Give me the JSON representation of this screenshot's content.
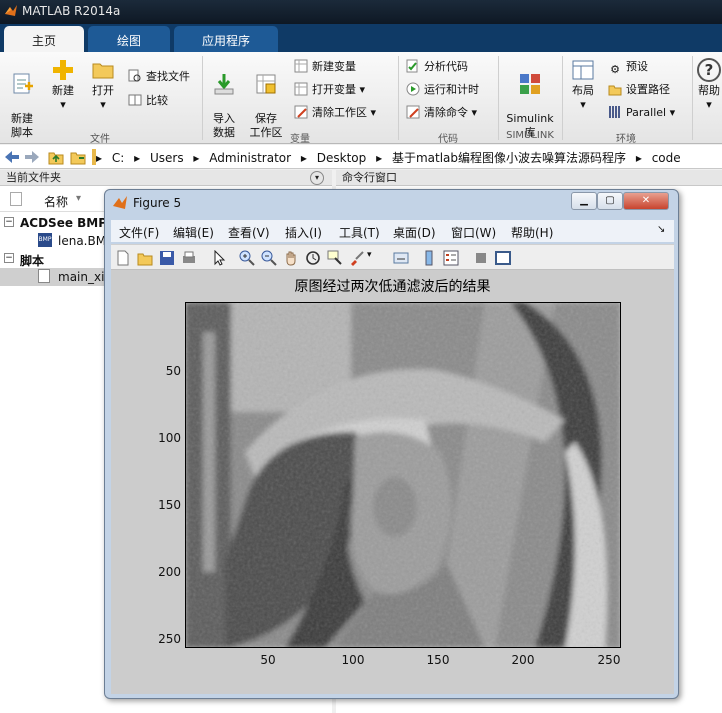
{
  "app": {
    "title": "MATLAB R2014a"
  },
  "tabs": [
    {
      "label": "主页"
    },
    {
      "label": "绘图"
    },
    {
      "label": "应用程序"
    }
  ],
  "ribbon": {
    "new_script": "新建\n脚本",
    "new": "新建",
    "open": "打开",
    "find_files": "查找文件",
    "compare": "比较",
    "import_data": "导入\n数据",
    "save_workspace": "保存\n工作区",
    "new_variable": "新建变量",
    "open_variable": "打开变量",
    "clear_workspace": "清除工作区",
    "analyze_code": "分析代码",
    "run_and_time": "运行和计时",
    "clear_commands": "清除命令",
    "simulink_library": "Simulink\n库",
    "layout": "布局",
    "preferences": "预设",
    "set_path": "设置路径",
    "parallel": "Parallel",
    "help": "帮助",
    "groups": {
      "file": "文件",
      "variable": "变量",
      "code": "代码",
      "simulink": "SIMULINK",
      "environment": "环境"
    }
  },
  "address": {
    "crumbs": [
      "C:",
      "Users",
      "Administrator",
      "Desktop",
      "基于matlab编程图像小波去噪算法源码程序",
      "code"
    ]
  },
  "current_folder": {
    "title": "当前文件夹",
    "name_header": "名称",
    "groups": [
      {
        "label": "ACDSee BMP",
        "items": [
          "lena.BMP"
        ]
      },
      {
        "label": "脚本",
        "items": [
          "main_xia"
        ]
      }
    ]
  },
  "command_window": {
    "title": "命令行窗口"
  },
  "figure": {
    "title": "Figure 5",
    "menu": [
      "文件(F)",
      "编辑(E)",
      "查看(V)",
      "插入(I)",
      "工具(T)",
      "桌面(D)",
      "窗口(W)",
      "帮助(H)"
    ],
    "plot_title": "原图经过两次低通滤波后的结果",
    "x_ticks": [
      "50",
      "100",
      "150",
      "200",
      "250"
    ],
    "y_ticks": [
      "50",
      "100",
      "150",
      "200",
      "250"
    ]
  },
  "colors": {
    "tab_bar": "#0f3a66",
    "active_tab": "#f4f4f4",
    "figure_frame": "#c3d3e6"
  }
}
